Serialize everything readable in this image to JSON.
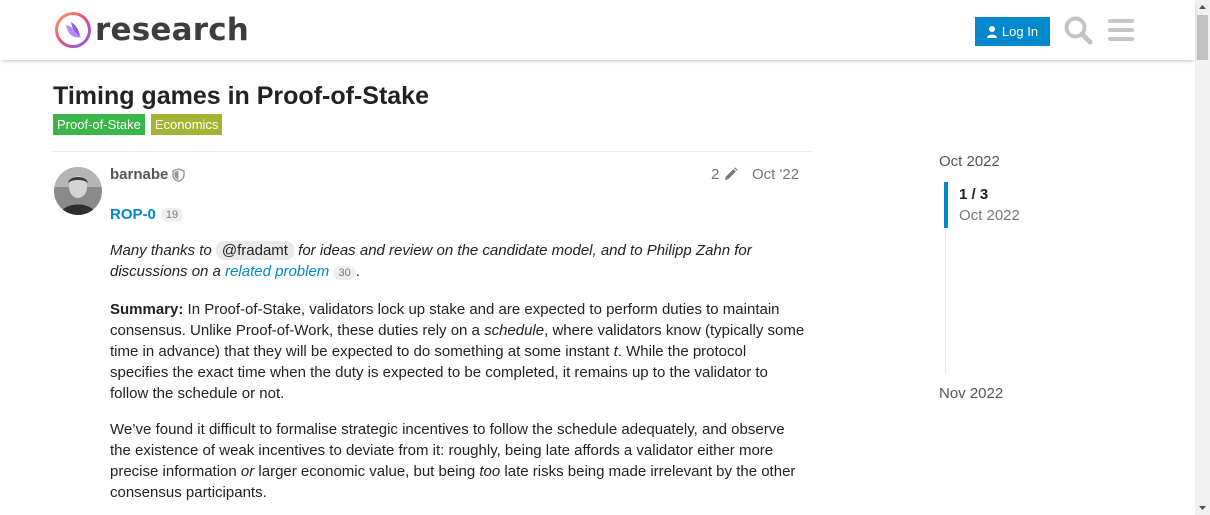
{
  "header": {
    "logo_text": "research",
    "login_label": "Log In"
  },
  "topic": {
    "title": "Timing games in Proof-of-Stake",
    "tags": [
      "Proof-of-Stake",
      "Economics"
    ]
  },
  "post": {
    "username": "barnabe",
    "edit_count": "2",
    "date": "Oct '22",
    "link": {
      "label": "ROP-0",
      "clicks": "19"
    },
    "intro": {
      "part1": "Many thanks to ",
      "mention": "@fradamt",
      "part2": " for ideas and review on the candidate model, and to Philipp Zahn for discussions on a ",
      "link_label": "related problem",
      "link_clicks": "30",
      "part3": "."
    },
    "summary": {
      "label": "Summary:",
      "part1": " In Proof-of-Stake, validators lock up stake and are expected to perform duties to maintain consensus. Unlike Proof-of-Work, these duties rely on a ",
      "emph": "schedule",
      "part2": ", where validators know (typically some time in advance) that they will be expected to do something at some instant ",
      "var": "t",
      "part3": ". While the protocol specifies the exact time when the duty is expected to be completed, it remains up to the validator to follow the schedule or not."
    },
    "para2": {
      "part1": "We’ve found it difficult to formalise strategic incentives to follow the schedule adequately, and observe the existence of weak incentives to deviate from it: roughly, being late affords a validator either more precise information ",
      "or": "or",
      "part2": " larger economic value, but being ",
      "too": "too",
      "part3": " late risks being made irrelevant by the other consensus participants."
    }
  },
  "timeline": {
    "start": "Oct 2022",
    "position": "1 / 3",
    "current_date": "Oct 2022",
    "end": "Nov 2022"
  },
  "colors": {
    "accent": "#0088cc",
    "tag_pos": "#3ab54a",
    "tag_econ": "#a5b332"
  }
}
